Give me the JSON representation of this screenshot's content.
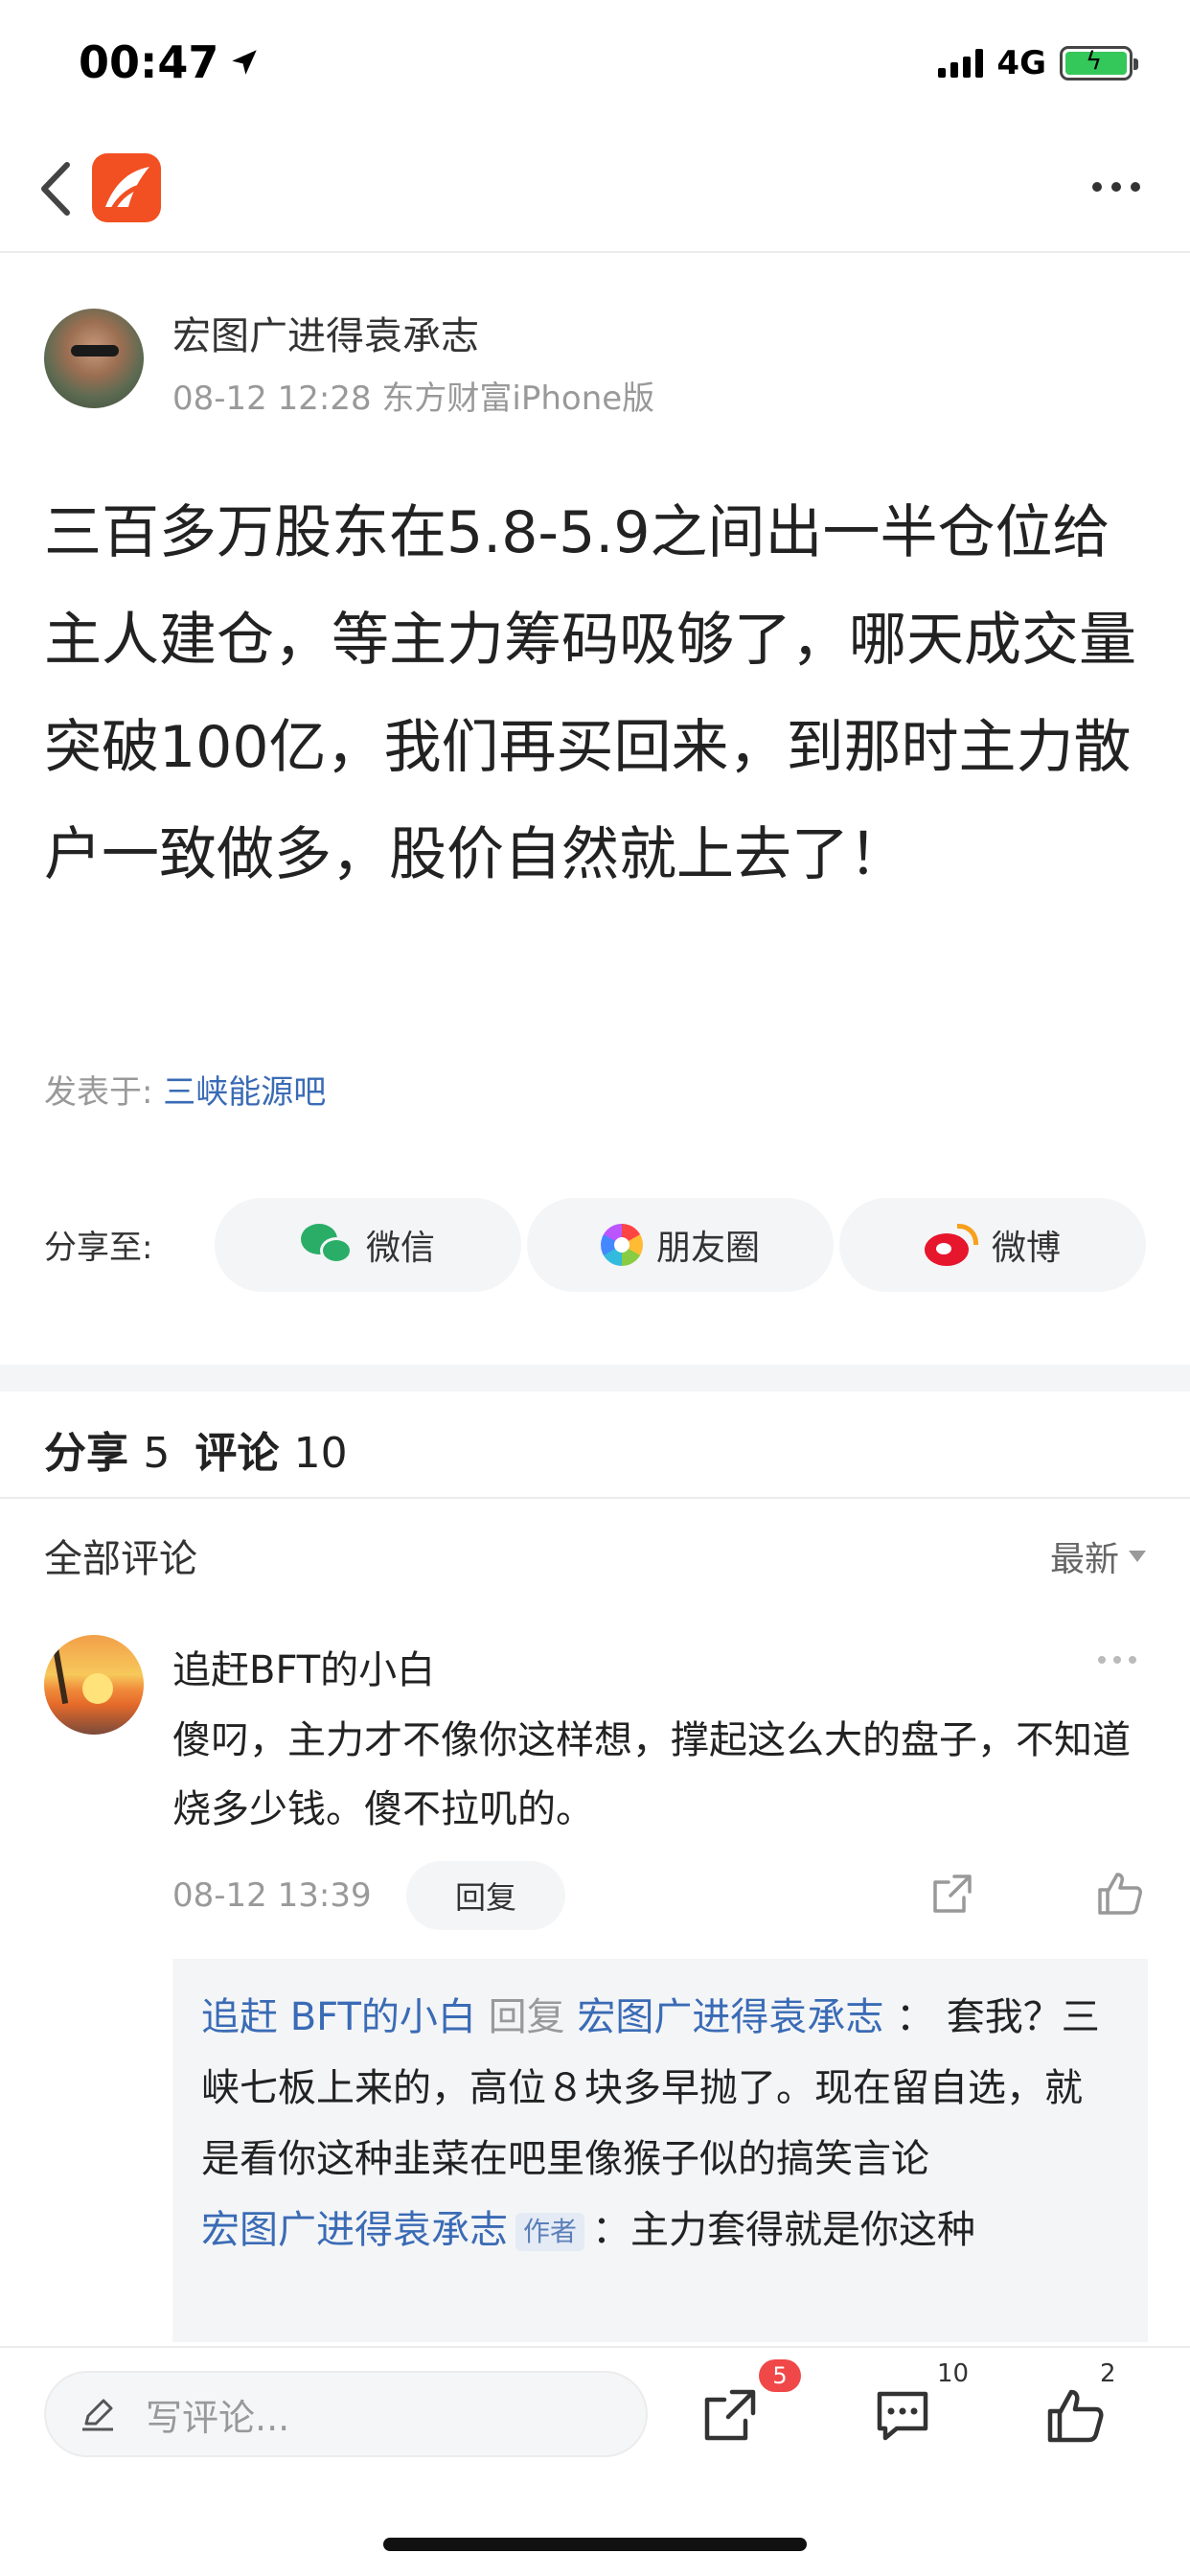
{
  "status_bar": {
    "time": "00:47",
    "network": "4G"
  },
  "post": {
    "author": "宏图广进得袁承志",
    "meta": "08-12 12:28 东方财富iPhone版",
    "content": "三百多万股东在5.8-5.9之间出一半仓位给主人建仓，等主力筹码吸够了，哪天成交量突破100亿，我们再买回来，到那时主力散户一致做多，股价自然就上去了！",
    "posted_label": "发表于:",
    "posted_bar": "三峡能源吧"
  },
  "share": {
    "label": "分享至:",
    "wechat": "微信",
    "moments": "朋友圈",
    "weibo": "微博"
  },
  "stats": {
    "share_label": "分享",
    "share_count": "5",
    "comment_label": "评论",
    "comment_count": "10"
  },
  "comments_header": {
    "title": "全部评论",
    "sort": "最新"
  },
  "comment": {
    "name": "追赶BFT的小白",
    "text": "傻叼，主力才不像你这样想，撑起这么大的盘子，不知道烧多少钱。傻不拉叽的。",
    "time": "08-12 13:39",
    "reply_button": "回复"
  },
  "replies": [
    {
      "from": "追赶 BFT的小白",
      "verb": "回复",
      "to": "宏图广进得袁承志",
      "text": "：  套我？三峡七板上来的，高位８块多早抛了。现在留自选，就是看你这种韭菜在吧里像猴子似的搞笑言论"
    },
    {
      "from": "宏图广进得袁承志",
      "tag": "作者",
      "text": "：主力套得就是你这种"
    }
  ],
  "bottom_bar": {
    "input_placeholder": "写评论...",
    "share_badge": "5",
    "comment_count": "10",
    "like_count": "2"
  }
}
